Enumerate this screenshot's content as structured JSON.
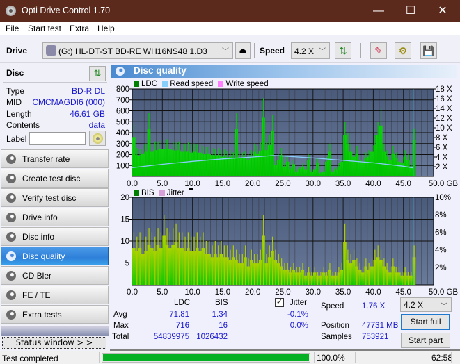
{
  "window": {
    "title": "Opti Drive Control 1.70",
    "minimize": "—",
    "maximize": "☐",
    "close": "✕"
  },
  "menu": [
    "File",
    "Start test",
    "Extra",
    "Help"
  ],
  "toolbar": {
    "drive_label": "Drive",
    "drive_value": "(G:)  HL-DT-ST BD-RE  WH16NS48 1.D3",
    "speed_label": "Speed",
    "speed_value": "4.2 X",
    "eject_icon": "⏏",
    "refresh_icon": "⇅",
    "erase_icon": "✎",
    "settings_icon": "⚙",
    "save_icon": "💾"
  },
  "disc": {
    "header": "Disc",
    "rows": [
      {
        "key": "Type",
        "value": "BD-R DL"
      },
      {
        "key": "MID",
        "value": "CMCMAGDI6 (000)"
      },
      {
        "key": "Length",
        "value": "46.61 GB"
      },
      {
        "key": "Contents",
        "value": "data"
      }
    ],
    "label_key": "Label",
    "label_value": ""
  },
  "nav": [
    {
      "label": "Transfer rate",
      "active": false
    },
    {
      "label": "Create test disc",
      "active": false
    },
    {
      "label": "Verify test disc",
      "active": false
    },
    {
      "label": "Drive info",
      "active": false
    },
    {
      "label": "Disc info",
      "active": false
    },
    {
      "label": "Disc quality",
      "active": true
    },
    {
      "label": "CD Bler",
      "active": false
    },
    {
      "label": "FE / TE",
      "active": false
    },
    {
      "label": "Extra tests",
      "active": false
    }
  ],
  "status_window_button": "Status window > >",
  "main": {
    "title": "Disc quality"
  },
  "chart_data": [
    {
      "type": "bar",
      "title": "LDC",
      "legend": [
        {
          "name": "LDC",
          "color": "#008000"
        },
        {
          "name": "Read speed",
          "color": "#87cefa"
        },
        {
          "name": "Write speed",
          "color": "#ff80ff"
        }
      ],
      "xlabel": "GB",
      "x_ticks": [
        "0.0",
        "5.0",
        "10.0",
        "15.0",
        "20.0",
        "25.0",
        "30.0",
        "35.0",
        "40.0",
        "45.0",
        "50.0 GB"
      ],
      "xlim": [
        0,
        50
      ],
      "ylim": [
        0,
        800
      ],
      "y_ticks": [
        "100",
        "200",
        "300",
        "400",
        "500",
        "600",
        "700",
        "800"
      ],
      "y2lim": [
        0,
        18
      ],
      "y2_ticks": [
        "2 X",
        "4 X",
        "6 X",
        "8 X",
        "10 X",
        "12 X",
        "14 X",
        "16 X",
        "18 X"
      ],
      "grid": true,
      "legend_position": "top-left",
      "series": [
        {
          "name": "LDC",
          "x": [
            0.0,
            0.5,
            1.0,
            1.5,
            2.0,
            2.5,
            3.0,
            3.5,
            4.0,
            4.5,
            5.0,
            5.5,
            6.0,
            6.5,
            7.0,
            7.5,
            8.0,
            8.5,
            9.0,
            9.5,
            10.0,
            10.5,
            11.0,
            11.5,
            12.0,
            12.5,
            13.0,
            13.5,
            14.0,
            14.5,
            15.0,
            15.5,
            16.0,
            16.5,
            17.0,
            17.5,
            18.0,
            18.5,
            19.0,
            19.5,
            20.0,
            20.5,
            21.0,
            21.5,
            22.0,
            22.5,
            23.0,
            23.5,
            24.0,
            24.5,
            25.0,
            25.5,
            26.0,
            26.5,
            27.0,
            27.5,
            28.0,
            28.5,
            29.0,
            29.5,
            30.0,
            30.5,
            31.0,
            31.5,
            32.0,
            32.5,
            33.0,
            33.5,
            34.0,
            34.5,
            35.0,
            35.5,
            36.0,
            36.5,
            37.0,
            37.5,
            38.0,
            38.5,
            39.0,
            39.5,
            40.0,
            40.5,
            41.0,
            41.5,
            42.0,
            42.5,
            43.0,
            43.5,
            44.0,
            44.5,
            45.0,
            45.5,
            46.0,
            46.5
          ],
          "values": [
            480,
            260,
            250,
            280,
            300,
            580,
            300,
            320,
            320,
            330,
            330,
            340,
            330,
            320,
            310,
            320,
            300,
            300,
            310,
            290,
            300,
            290,
            290,
            280,
            270,
            280,
            260,
            250,
            260,
            240,
            250,
            230,
            240,
            220,
            580,
            230,
            220,
            230,
            200,
            240,
            300,
            280,
            310,
            716,
            320,
            380,
            560,
            140,
            200,
            260,
            120,
            180,
            80,
            150,
            60,
            90,
            120,
            80,
            200,
            60,
            80,
            170,
            40,
            60,
            180,
            300,
            60,
            80,
            120,
            180,
            500,
            400,
            300,
            240,
            280,
            200,
            180,
            220,
            240,
            300,
            380,
            500,
            620,
            300,
            240,
            200,
            280,
            220,
            180,
            160,
            240,
            200,
            120,
            440
          ]
        },
        {
          "name": "Read speed",
          "unit": "X",
          "x": [
            0,
            5,
            10,
            15,
            20,
            23.5,
            25,
            30,
            35,
            40,
            45,
            46.6
          ],
          "values": [
            1.8,
            2.5,
            3.1,
            3.6,
            4.0,
            4.3,
            4.2,
            3.8,
            3.3,
            2.8,
            2.1,
            1.76
          ]
        }
      ]
    },
    {
      "type": "bar",
      "title": "BIS",
      "legend": [
        {
          "name": "BIS",
          "color": "#008000"
        },
        {
          "name": "Jitter",
          "color": "#d8a0d8"
        }
      ],
      "xlabel": "GB",
      "x_ticks": [
        "0.0",
        "5.0",
        "10.0",
        "15.0",
        "20.0",
        "25.0",
        "30.0",
        "35.0",
        "40.0",
        "45.0",
        "50.0 GB"
      ],
      "xlim": [
        0,
        50
      ],
      "ylim": [
        0,
        20
      ],
      "y_ticks": [
        "5",
        "10",
        "15",
        "20"
      ],
      "y2lim": [
        0,
        10
      ],
      "y2_ticks": [
        "2%",
        "4%",
        "6%",
        "8%",
        "10%"
      ],
      "grid": true,
      "legend_position": "top-left",
      "series": [
        {
          "name": "BIS",
          "x": [
            0.0,
            0.5,
            1.0,
            1.5,
            2.0,
            2.5,
            3.0,
            3.5,
            4.0,
            4.5,
            5.0,
            5.5,
            6.0,
            6.5,
            7.0,
            7.5,
            8.0,
            8.5,
            9.0,
            9.5,
            10.0,
            10.5,
            11.0,
            11.5,
            12.0,
            12.5,
            13.0,
            13.5,
            14.0,
            14.5,
            15.0,
            15.5,
            16.0,
            16.5,
            17.0,
            17.5,
            18.0,
            18.5,
            19.0,
            19.5,
            20.0,
            20.5,
            21.0,
            21.5,
            22.0,
            22.5,
            23.0,
            23.5,
            24.0,
            24.5,
            25.0,
            25.5,
            26.0,
            26.5,
            27.0,
            27.5,
            28.0,
            28.5,
            29.0,
            29.5,
            30.0,
            30.5,
            31.0,
            31.5,
            32.0,
            32.5,
            33.0,
            33.5,
            34.0,
            34.5,
            35.0,
            35.5,
            36.0,
            36.5,
            37.0,
            37.5,
            38.0,
            38.5,
            39.0,
            39.5,
            40.0,
            40.5,
            41.0,
            41.5,
            42.0,
            42.5,
            43.0,
            43.5,
            44.0,
            44.5,
            45.0,
            45.5,
            46.0,
            46.5
          ],
          "values": [
            12,
            11,
            12,
            10,
            11,
            13,
            12,
            11,
            13,
            12,
            16,
            13,
            12,
            13,
            14,
            12,
            12,
            11,
            12,
            11,
            11,
            12,
            11,
            12,
            10,
            10,
            9,
            10,
            9,
            10,
            9,
            9,
            8,
            9,
            8,
            7,
            7,
            9,
            6,
            8,
            7,
            7,
            8,
            16,
            7,
            9,
            11,
            8,
            7,
            6,
            5,
            5,
            4,
            5,
            4,
            4,
            5,
            3,
            4,
            3,
            4,
            3,
            3,
            4,
            3,
            5,
            3,
            3,
            4,
            5,
            14,
            8,
            7,
            8,
            6,
            5,
            4,
            6,
            5,
            6,
            8,
            9,
            8,
            6,
            5,
            4,
            6,
            4,
            4,
            3,
            4,
            3,
            3,
            9
          ]
        },
        {
          "name": "Jitter",
          "x": [],
          "values": []
        }
      ]
    }
  ],
  "stats": {
    "col_ldc": "LDC",
    "col_bis": "BIS",
    "rows": [
      {
        "label": "Avg",
        "ldc": "71.81",
        "bis": "1.34",
        "jitter": "-0.1%"
      },
      {
        "label": "Max",
        "ldc": "716",
        "bis": "16",
        "jitter": "0.0%"
      },
      {
        "label": "Total",
        "ldc": "54839975",
        "bis": "1026432",
        "jitter": ""
      }
    ],
    "jitter_label": "Jitter",
    "jitter_checked": true,
    "speed_label": "Speed",
    "speed_value": "1.76 X",
    "position_label": "Position",
    "position_value": "47731 MB",
    "samples_label": "Samples",
    "samples_value": "753921",
    "speed_select": "4.2 X",
    "start_full": "Start full",
    "start_part": "Start part"
  },
  "statusbar": {
    "text": "Test completed",
    "progress_percent": 100,
    "progress_label": "100.0%",
    "elapsed": "62:58"
  }
}
